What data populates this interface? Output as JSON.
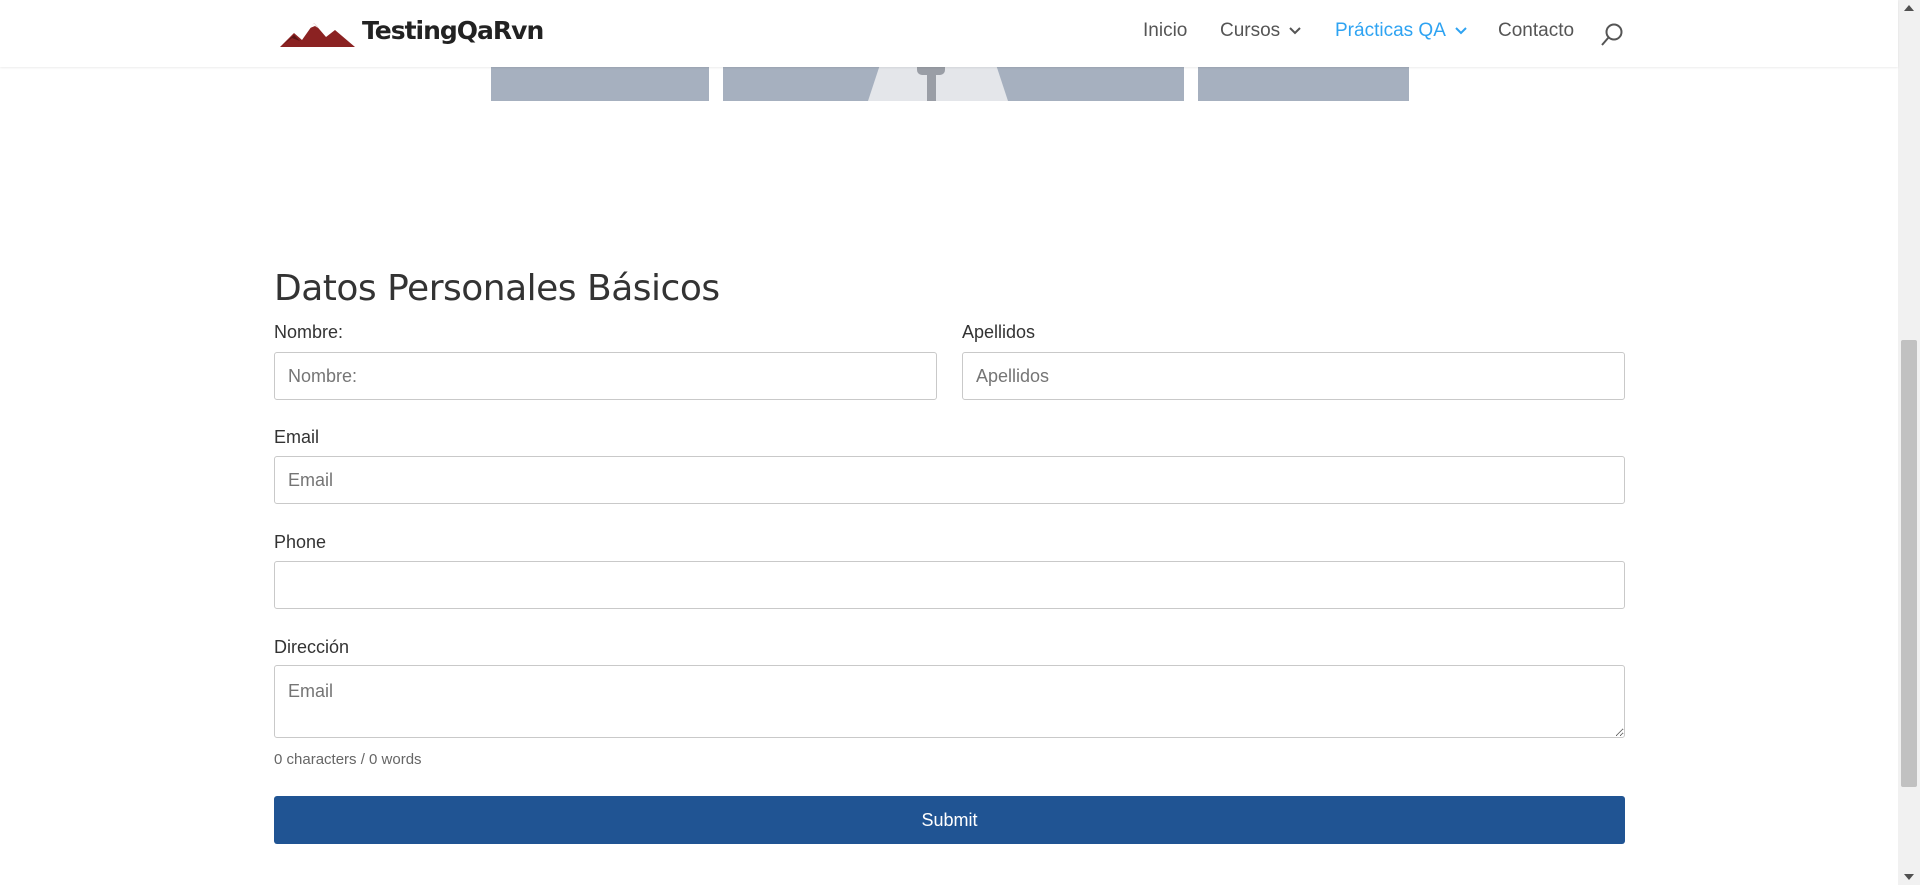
{
  "brand": {
    "name": "TestingQaRvn",
    "logo_icon": "mountain-logo-icon",
    "logo_color": "#8b2222"
  },
  "nav": {
    "items": [
      {
        "label": "Inicio"
      },
      {
        "label": "Cursos"
      },
      {
        "label": "Prácticas QA"
      },
      {
        "label": "Contacto"
      }
    ],
    "active_color": "#2ea3f2",
    "search_icon": "search-icon"
  },
  "form": {
    "title": "Datos Personales Básicos",
    "nombre": {
      "label": "Nombre:",
      "placeholder": "Nombre:",
      "value": ""
    },
    "apellidos": {
      "label": "Apellidos",
      "placeholder": "Apellidos",
      "value": ""
    },
    "email": {
      "label": "Email",
      "placeholder": "Email",
      "value": ""
    },
    "phone": {
      "label": "Phone",
      "placeholder": "",
      "value": ""
    },
    "direccion": {
      "label": "Dirección",
      "placeholder": "Email",
      "value": ""
    },
    "counter": "0 characters / 0 words",
    "submit_label": "Submit",
    "submit_color": "#205493"
  }
}
